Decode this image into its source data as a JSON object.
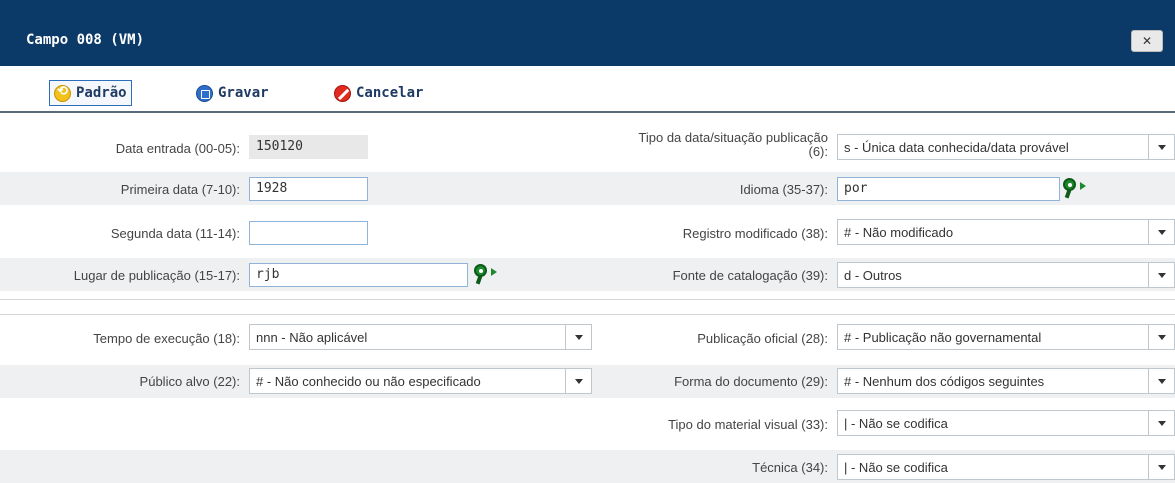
{
  "dialog": {
    "title": "Campo 008 (VM)",
    "close_label": "✕"
  },
  "toolbar": {
    "default_label": "Padrão",
    "save_label": "Gravar",
    "cancel_label": "Cancelar"
  },
  "fields": {
    "data_entrada": {
      "label": "Data entrada (00-05):",
      "value": "150120"
    },
    "primeira_data": {
      "label": "Primeira data (7-10):",
      "value": "1928"
    },
    "segunda_data": {
      "label": "Segunda data (11-14):",
      "value": ""
    },
    "lugar_publicacao": {
      "label": "Lugar de publicação (15-17):",
      "value": "rjb"
    },
    "tipo_data": {
      "label_line1": "Tipo da data/situação publicação",
      "label_line2": "(6):",
      "value": "s  - Única data conhecida/data provável"
    },
    "idioma": {
      "label": "Idioma (35-37):",
      "value": "por"
    },
    "registro_modificado": {
      "label": "Registro modificado (38):",
      "value": "#  - Não modificado"
    },
    "fonte_catalogacao": {
      "label": "Fonte de catalogação (39):",
      "value": "d  - Outros"
    },
    "tempo_execucao": {
      "label": "Tempo de execução (18):",
      "value": "nnn - Não aplicável"
    },
    "publico_alvo": {
      "label": "Público alvo (22):",
      "value": "#  - Não conhecido ou não especificado"
    },
    "publicacao_oficial": {
      "label": "Publicação oficial (28):",
      "value": "#  - Publicação não governamental"
    },
    "forma_documento": {
      "label": "Forma do documento (29):",
      "value": "#  - Nenhum dos códigos seguintes"
    },
    "tipo_material_visual": {
      "label": "Tipo do material visual (33):",
      "value": "|  - Não se codifica"
    },
    "tecnica": {
      "label": "Técnica (34):",
      "value": "|  - Não se codifica"
    }
  },
  "colors": {
    "titlebar": "#0c3a68",
    "row_shade": "#eef0f2",
    "field_border": "#8fb3d9",
    "lookup_green": "#1b8a2c"
  },
  "icons": {
    "default": "refresh-icon",
    "save": "save-icon",
    "cancel": "cancel-icon",
    "lookup": "lookup-icon"
  }
}
